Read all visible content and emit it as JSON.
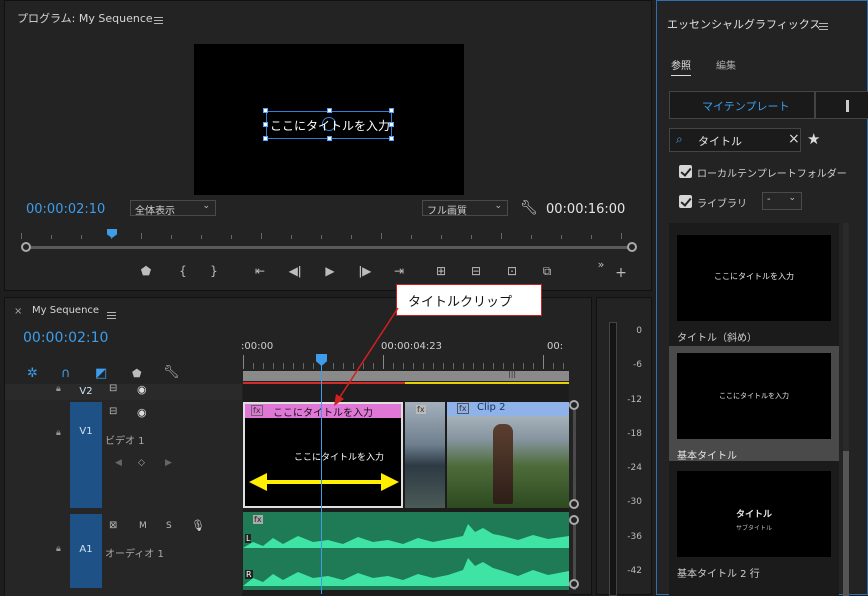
{
  "program": {
    "title": "プログラム: My Sequence",
    "overlay_text": "ここにタイトルを入力",
    "timecode": "00:00:02:10",
    "zoom": "全体表示",
    "quality": "フル画質",
    "duration": "00:00:16:00",
    "playhead_fraction": 0.14
  },
  "callout": "タイトルクリップ",
  "timeline": {
    "title": "My Sequence",
    "timecode": "00:00:02:10",
    "ruler": [
      ":00:00",
      "00:00:04:23",
      "00:"
    ],
    "tracks": {
      "v2": "V2",
      "v1": "V1",
      "v1_name": "ビデオ 1",
      "a1": "A1",
      "a1_name": "オーディオ 1",
      "m": "M",
      "s": "S"
    },
    "title_clip": "ここにタイトルを入力",
    "title_clip_overlay": "ここにタイトルを入力",
    "clip2": "Clip 2",
    "fx": "fx",
    "channel_l": "L",
    "channel_r": "R"
  },
  "meter": {
    "ticks": [
      "0",
      "-6",
      "-12",
      "-18",
      "-24",
      "-30",
      "-36",
      "-42"
    ]
  },
  "essential_graphics": {
    "title": "エッセンシャルグラフィックス",
    "tab_browse": "参照",
    "tab_edit": "編集",
    "my_templates": "マイテンプレート",
    "search_value": "タイトル",
    "local_folder": "ローカルテンプレートフォルダー",
    "library": "ライブラリ",
    "library_select": "-",
    "templates": [
      {
        "label": "タイトル（斜め）",
        "preview": "ここにタイトルを入力"
      },
      {
        "label": "基本タイトル",
        "preview": "ここにタイトルを入力"
      },
      {
        "label": "基本タイトル 2 行",
        "preview": "タイトル",
        "preview_sub": "サブタイトル"
      }
    ]
  }
}
